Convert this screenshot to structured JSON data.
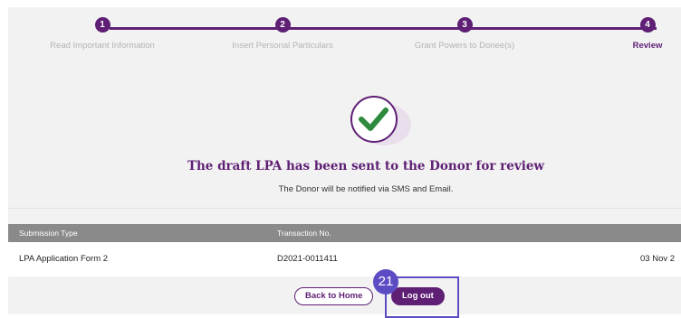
{
  "stepper": {
    "steps": [
      {
        "number": "1",
        "label": "Read Important Information"
      },
      {
        "number": "2",
        "label": "Insert Personal Particulars"
      },
      {
        "number": "3",
        "label": "Grant Powers to Donee(s)"
      },
      {
        "number": "4",
        "label": "Review"
      }
    ],
    "active_step": 4
  },
  "result": {
    "icon": "check-icon",
    "title": "The draft LPA has been sent to the Donor for review",
    "subtitle": "The Donor will be notified via SMS and Email."
  },
  "table": {
    "headers": [
      "Submission Type",
      "Transaction No."
    ],
    "rows": [
      {
        "submission_type": "LPA Application Form 2",
        "transaction_no": "D2021-0011411",
        "date": "03 Nov 2"
      }
    ]
  },
  "actions": {
    "back_label": "Back to Home",
    "logout_label": "Log out"
  },
  "annotation": {
    "badge": "21"
  },
  "colors": {
    "brand": "#5e1f74",
    "success": "#2e8b3d",
    "annotation": "#5b4cc4"
  }
}
